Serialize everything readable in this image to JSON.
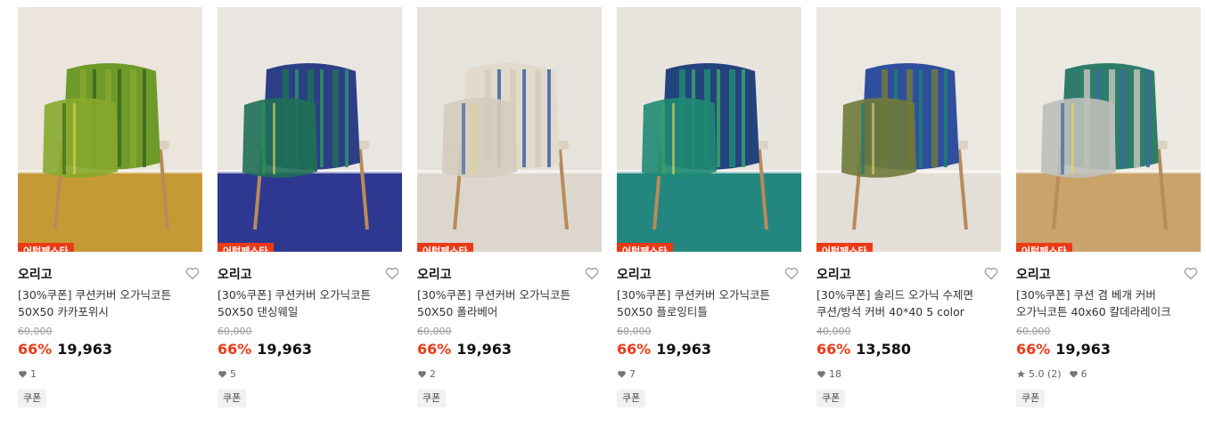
{
  "products": [
    {
      "tag": "어텀페스타",
      "brand": "오리고",
      "title_line1": "[30%쿠폰] 쿠션커버 오가닉코튼",
      "title_line2": "50X50 카카포위시",
      "original_price": "60,000",
      "discount": "66%",
      "price": "19,963",
      "likes": "1",
      "rating": null,
      "coupon": "쿠폰",
      "colors": {
        "bg": "#ebe5dc",
        "floor": "#c59a36",
        "main": "#6e9a2a",
        "accent": "#3a6a1c",
        "second": "#86a82b"
      }
    },
    {
      "tag": "어텀페스타",
      "brand": "오리고",
      "title_line1": "[30%쿠폰] 쿠션커버 오가닉코튼",
      "title_line2": "50X50 댄싱웨일",
      "original_price": "60,000",
      "discount": "66%",
      "price": "19,963",
      "likes": "5",
      "rating": null,
      "coupon": "쿠폰",
      "colors": {
        "bg": "#e9e6e1",
        "floor": "#2f3890",
        "main": "#2c3f86",
        "accent": "#2f8f63",
        "second": "#1f6f57"
      }
    },
    {
      "tag": "어텀페스타",
      "brand": "오리고",
      "title_line1": "[30%쿠폰] 쿠션커버 오가닉코튼",
      "title_line2": "50X50 폴라베어",
      "original_price": "60,000",
      "discount": "66%",
      "price": "19,963",
      "likes": "2",
      "rating": null,
      "coupon": "쿠폰",
      "colors": {
        "bg": "#e6e2dc",
        "floor": "#dcd6cc",
        "main": "#e3dacb",
        "accent": "#3d63a8",
        "second": "#d4ccbe"
      }
    },
    {
      "tag": "어텀페스타",
      "brand": "오리고",
      "title_line1": "[30%쿠폰] 쿠션커버 오가닉코튼",
      "title_line2": "50X50 플로잉티틀",
      "original_price": "60,000",
      "discount": "66%",
      "price": "19,963",
      "likes": "7",
      "rating": null,
      "coupon": "쿠폰",
      "colors": {
        "bg": "#e8e4de",
        "floor": "#23877f",
        "main": "#23437d",
        "accent": "#3aa16a",
        "second": "#1f8a73"
      }
    },
    {
      "tag": "어텀페스타",
      "brand": "오리고",
      "title_line1": "[30%쿠폰] 솔리드 오가닉 수제면",
      "title_line2": "쿠션/방석 커버 40*40 5 color",
      "original_price": "40,000",
      "discount": "66%",
      "price": "13,580",
      "likes": "18",
      "rating": null,
      "coupon": "쿠폰",
      "colors": {
        "bg": "#ebe7e1",
        "floor": "#e3ded6",
        "main": "#2f4f9e",
        "accent": "#1e7e6a",
        "second": "#6e7a3a"
      }
    },
    {
      "tag": "어텀페스타",
      "brand": "오리고",
      "title_line1": "[30%쿠폰] 쿠션 겸 베개 커버",
      "title_line2": "오가닉코튼 40x60 칼데라레이크",
      "original_price": "60,000",
      "discount": "66%",
      "price": "19,963",
      "likes": "6",
      "rating": "5.0 (2)",
      "coupon": "쿠폰",
      "colors": {
        "bg": "#ece8e2",
        "floor": "#c9a36a",
        "main": "#2e7d6a",
        "accent": "#3c68a8",
        "second": "#bfbfba"
      }
    }
  ],
  "icons": {
    "like": "heart-outline-icon",
    "likes_count": "heart-filled-icon",
    "rating": "star-icon"
  }
}
